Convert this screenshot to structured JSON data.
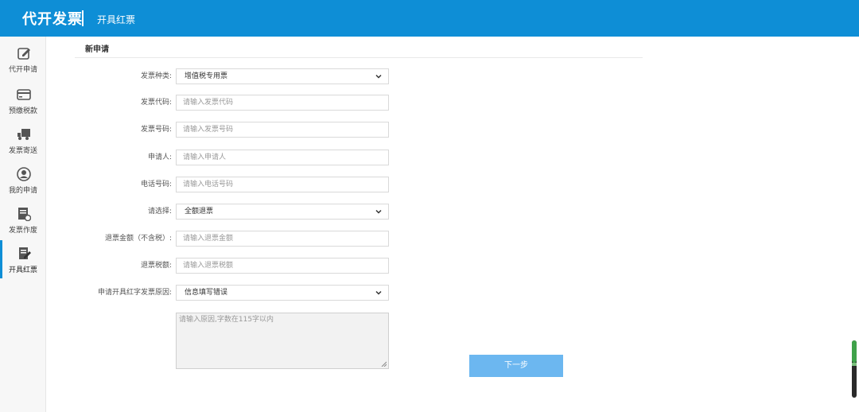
{
  "header": {
    "app_title": "代开发票",
    "sub_title": "开具红票",
    "bg_color": "#0e8ed6"
  },
  "sidebar": {
    "items": [
      {
        "label": "代开申请",
        "icon": "edit-icon"
      },
      {
        "label": "预缴税款",
        "icon": "card-icon"
      },
      {
        "label": "发票寄送",
        "icon": "truck-icon"
      },
      {
        "label": "我的申请",
        "icon": "user-circle-icon"
      },
      {
        "label": "发票作废",
        "icon": "document-cancel-icon"
      },
      {
        "label": "开具红票",
        "icon": "document-edit-icon",
        "active": true
      }
    ]
  },
  "form": {
    "section_title": "新申请",
    "invoice_type": {
      "label": "发票种类:",
      "value": "增值税专用票"
    },
    "invoice_code": {
      "label": "发票代码:",
      "placeholder": "请输入发票代码"
    },
    "invoice_number": {
      "label": "发票号码:",
      "placeholder": "请输入发票号码"
    },
    "applicant": {
      "label": "申请人:",
      "placeholder": "请输入申请人"
    },
    "phone": {
      "label": "电话号码:",
      "placeholder": "请输入电话号码"
    },
    "refund_choice": {
      "label": "请选择:",
      "value": "全额退票"
    },
    "refund_amount": {
      "label": "退票金额（不含税）:",
      "placeholder": "请输入退票金额"
    },
    "refund_tax": {
      "label": "退票税额:",
      "placeholder": "请输入退票税额"
    },
    "reason_select": {
      "label": "申请开具红字发票原因:",
      "value": "信息填写错误"
    },
    "reason_text": {
      "placeholder": "请输入原因,字数在115字以内"
    },
    "next_label": "下一步"
  }
}
